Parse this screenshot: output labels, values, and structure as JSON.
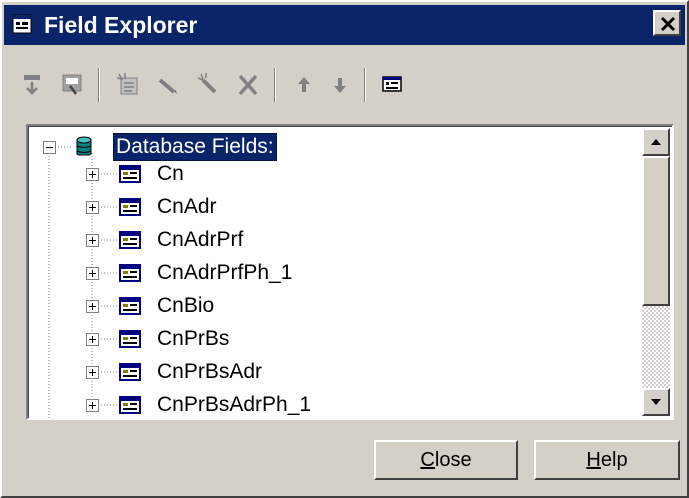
{
  "window": {
    "title": "Field Explorer"
  },
  "toolbar": {
    "icons": [
      "insert-field-icon",
      "browse-field-icon",
      "new-field-icon",
      "edit-field-icon",
      "rename-field-icon",
      "delete-field-icon",
      "move-up-icon",
      "move-down-icon",
      "properties-icon"
    ]
  },
  "tree": {
    "root_label": "Database Fields:",
    "items": [
      {
        "label": "Cn"
      },
      {
        "label": "CnAdr"
      },
      {
        "label": "CnAdrPrf"
      },
      {
        "label": "CnAdrPrfPh_1"
      },
      {
        "label": "CnBio"
      },
      {
        "label": "CnPrBs"
      },
      {
        "label": "CnPrBsAdr"
      },
      {
        "label": "CnPrBsAdrPh_1"
      }
    ]
  },
  "buttons": {
    "close": {
      "accel": "C",
      "rest": "lose"
    },
    "help": {
      "accel": "H",
      "rest": "elp"
    }
  },
  "colors": {
    "titlebar": "#0a246a",
    "face": "#d4d0c8",
    "tree_bg": "#ffffff"
  }
}
